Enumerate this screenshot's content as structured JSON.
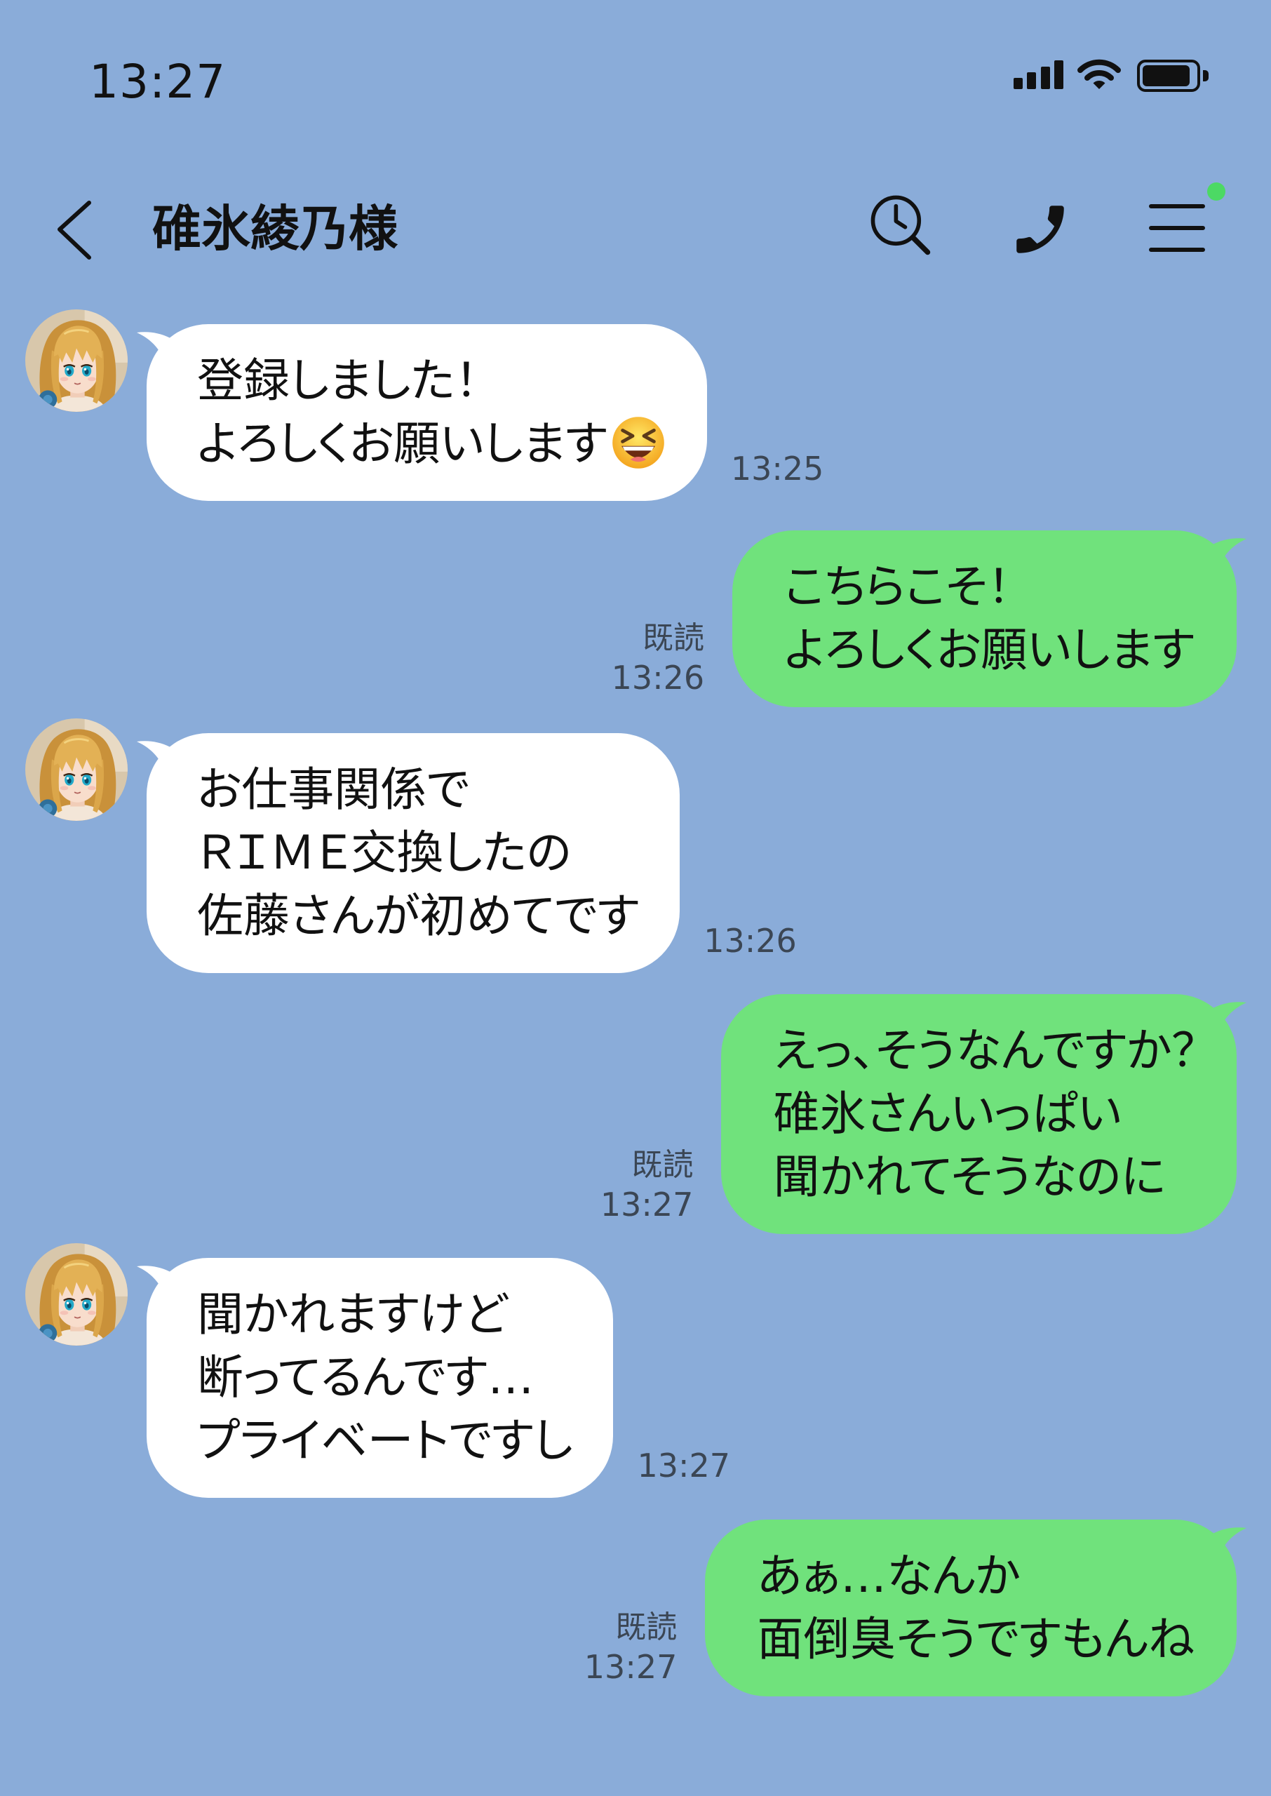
{
  "status_bar": {
    "time": "13:27",
    "signal_bars": 4,
    "battery_level": 0.9,
    "icons": [
      "signal-icon",
      "wifi-icon",
      "battery-icon"
    ]
  },
  "header": {
    "title": "碓氷綾乃様",
    "icons": [
      "chevron-left-icon",
      "search-history-icon",
      "phone-icon",
      "hamburger-menu-icon"
    ]
  },
  "messages": [
    {
      "lines": [
        "登録しました！",
        "よろしくお願いします"
      ],
      "emoji": "laughing-face-emoji-icon",
      "time": "13:25"
    },
    {
      "lines": [
        "こちらこそ！",
        "よろしくお願いします"
      ],
      "read": "既読",
      "time": "13:26"
    },
    {
      "lines": [
        "お仕事関係で",
        "ＲＩＭＥ交換したの",
        "佐藤さんが初めてです"
      ],
      "time": "13:26"
    },
    {
      "lines": [
        "えっ、そうなんですか？",
        "碓氷さんいっぱい",
        "聞かれてそうなのに"
      ],
      "read": "既読",
      "time": "13:27"
    },
    {
      "lines": [
        "聞かれますけど",
        "断ってるんです…",
        "プライベートですし"
      ],
      "time": "13:27"
    },
    {
      "lines": [
        "あぁ…なんか",
        "面倒臭そうですもんね"
      ],
      "read": "既読",
      "time": "13:27"
    }
  ],
  "colors": {
    "background": "#8aacd9",
    "incoming_bubble": "#ffffff",
    "outgoing_bubble": "#70e27c",
    "meta_text": "#3b4654",
    "text": "#111111",
    "online_dot": "#4cd964"
  }
}
